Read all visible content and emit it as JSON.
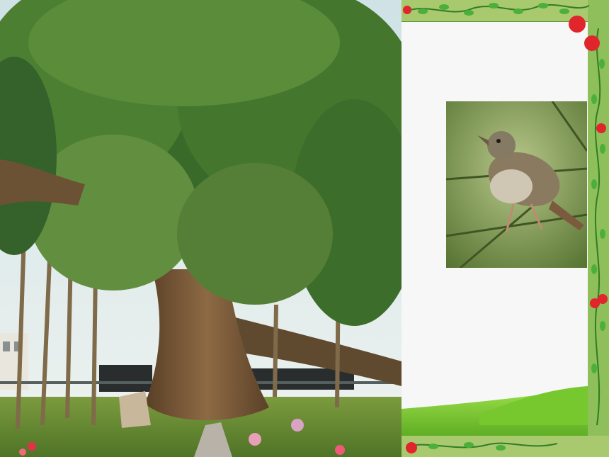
{
  "scene": {
    "left_photo": "tree-photo",
    "right_panel": "decorative-frame",
    "inset_photo": "bird-photo"
  },
  "colors": {
    "sky": "#d9e9ec",
    "foliage_dark": "#2f5a22",
    "foliage_light": "#6e9a3e",
    "trunk": "#7a5a38",
    "ground": "#6a8f35",
    "frame_green": "#5f9a35",
    "panel_white": "#f7f7f7",
    "hill_green": "#8cd23c",
    "berry_red": "#e0262c",
    "bird_body": "#8a7a60",
    "bird_belly": "#cfc7b4"
  }
}
